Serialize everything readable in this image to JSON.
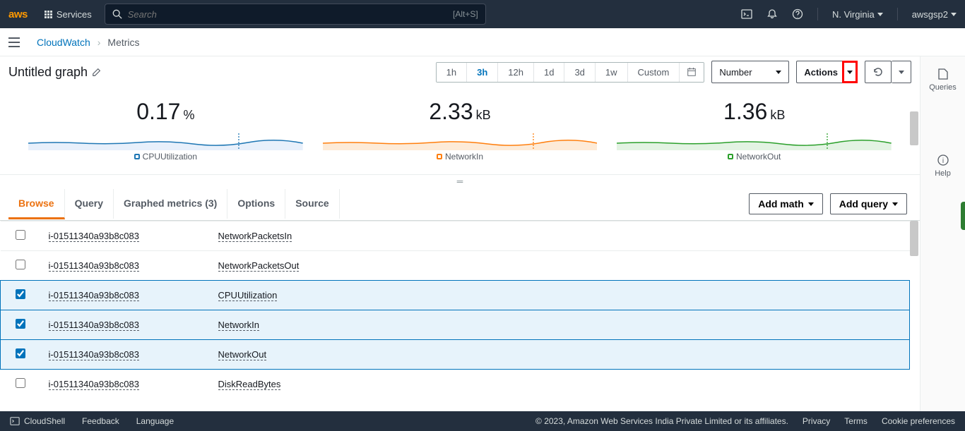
{
  "nav": {
    "logo": "aws",
    "services": "Services",
    "search_placeholder": "Search",
    "search_hint": "[Alt+S]",
    "region": "N. Virginia",
    "user": "awsgsp2"
  },
  "breadcrumb": {
    "root": "CloudWatch",
    "current": "Metrics"
  },
  "graph": {
    "title": "Untitled graph",
    "time_options": [
      "1h",
      "3h",
      "12h",
      "1d",
      "3d",
      "1w",
      "Custom"
    ],
    "active_time": "3h",
    "visualization": "Number",
    "actions_label": "Actions"
  },
  "chart_data": [
    {
      "value": "0.17",
      "unit": "%",
      "legend": "CPUUtilization",
      "color": "#1f77b4",
      "fill": "#e8f0fb"
    },
    {
      "value": "2.33",
      "unit": "kB",
      "legend": "NetworkIn",
      "color": "#ff7f0e",
      "fill": "#fdebd8"
    },
    {
      "value": "1.36",
      "unit": "kB",
      "legend": "NetworkOut",
      "color": "#2ca02c",
      "fill": "#e3f3e3"
    }
  ],
  "tabs": {
    "items": [
      "Browse",
      "Query",
      "Graphed metrics (3)",
      "Options",
      "Source"
    ],
    "active": "Browse",
    "add_math": "Add math",
    "add_query": "Add query"
  },
  "metrics": [
    {
      "selected": false,
      "instance": "i-01511340a93b8c083",
      "name": "NetworkPacketsIn"
    },
    {
      "selected": false,
      "instance": "i-01511340a93b8c083",
      "name": "NetworkPacketsOut"
    },
    {
      "selected": true,
      "instance": "i-01511340a93b8c083",
      "name": "CPUUtilization"
    },
    {
      "selected": true,
      "instance": "i-01511340a93b8c083",
      "name": "NetworkIn"
    },
    {
      "selected": true,
      "instance": "i-01511340a93b8c083",
      "name": "NetworkOut"
    },
    {
      "selected": false,
      "instance": "i-01511340a93b8c083",
      "name": "DiskReadBytes"
    }
  ],
  "sidebar": {
    "queries": "Queries",
    "help": "Help"
  },
  "footer": {
    "cloudshell": "CloudShell",
    "feedback": "Feedback",
    "language": "Language",
    "copyright": "© 2023, Amazon Web Services India Private Limited or its affiliates.",
    "privacy": "Privacy",
    "terms": "Terms",
    "cookies": "Cookie preferences"
  }
}
